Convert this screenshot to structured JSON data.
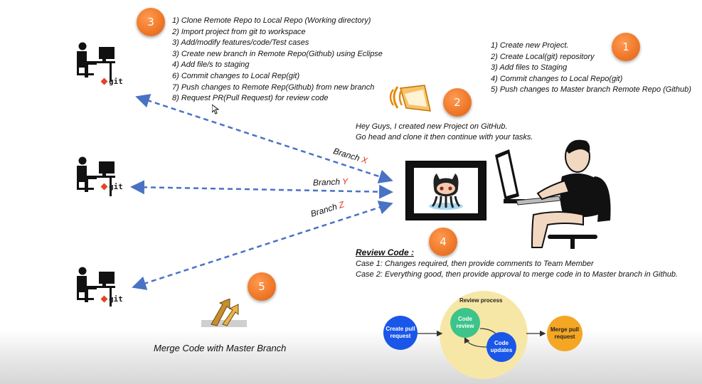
{
  "badges": {
    "b1": "1",
    "b2": "2",
    "b3": "3",
    "b4": "4",
    "b5": "5"
  },
  "dev_steps": [
    "1) Clone Remote Repo to Local Repo (Working directory)",
    "2) Import project from git to workspace",
    "3) Add/modify features/code/Test cases",
    "3) Create new branch in Remote Repo(Github) using Eclipse",
    "4) Add file/s to staging",
    "6) Commit changes to Local Rep(git)",
    "7) Push changes to Remote Rep(Github) from new branch",
    "8) Request PR(Pull Request) for review code"
  ],
  "lead_steps": [
    "1) Create new Project.",
    "2) Create Local(git) repository",
    "3) Add files to Staging",
    "4) Commit changes to Local Repo(git)",
    "5) Push changes to Master branch Remote Repo (Github)"
  ],
  "message": {
    "line1": "Hey Guys, I created new Project on GitHub.",
    "line2": "Go head and clone it then continue with your tasks."
  },
  "git_label": "git",
  "branches": [
    {
      "word": "Branch",
      "letter": "X"
    },
    {
      "word": "Branch",
      "letter": "Y"
    },
    {
      "word": "Branch",
      "letter": "Z"
    }
  ],
  "review": {
    "title": "Review Code :",
    "case1": "Case 1: Changes required, then provide comments to Team Member",
    "case2": "Case 2: Everything good, then provide approval to merge code in to Master branch in Github."
  },
  "merge_caption": "Merge Code with Master Branch",
  "review_process": {
    "title": "Review process",
    "create": "Create pull request",
    "code_review": "Code review",
    "code_updates": "Code updates",
    "merge": "Merge pull request"
  },
  "colors": {
    "badge": "#f07a2a",
    "arrow": "#4a72c4",
    "branch_letter": "#e03020",
    "git_diamond": "#e24329",
    "blue_circle": "#1a56e8",
    "green_circle": "#3cc48a",
    "merge_circle": "#f5a623",
    "process_bg": "#f7e7a6"
  }
}
